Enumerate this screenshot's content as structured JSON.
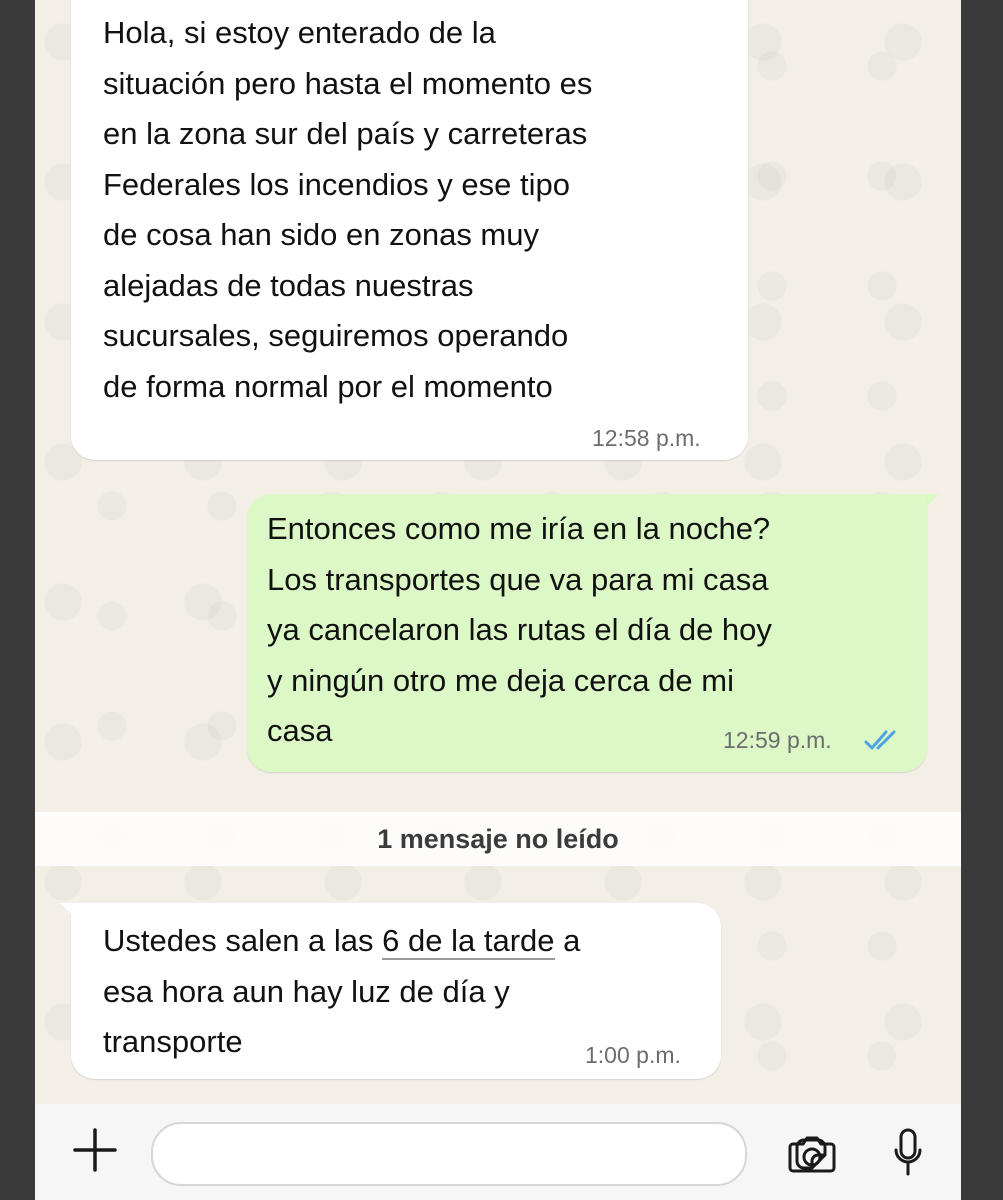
{
  "chat": {
    "messages": [
      {
        "direction": "incoming",
        "lines": [
          "Hola, si estoy enterado de la",
          "situación pero hasta el momento es",
          "en la zona sur del país y carreteras",
          "Federales los incendios y ese tipo",
          "de cosa han sido en zonas muy",
          "alejadas de todas nuestras",
          "sucursales, seguiremos operando",
          "de forma normal por el momento"
        ],
        "time": "12:58 p.m."
      },
      {
        "direction": "outgoing",
        "lines": [
          "Entonces como me iría en la noche?",
          "Los transportes que va para mi casa",
          "ya cancelaron las rutas el día de hoy",
          "y ningún otro me deja cerca de mi",
          "casa"
        ],
        "time": "12:59 p.m.",
        "status_icon": "double-check-read-icon"
      },
      {
        "direction": "incoming",
        "line1_before": "Ustedes salen a las ",
        "line1_link": "6 de la tarde",
        "line1_after": " a",
        "line2": "esa hora aun hay luz de día y",
        "line3": "transporte",
        "time": "1:00 p.m."
      }
    ],
    "unread_label": "1 mensaje no leído"
  },
  "composer": {
    "input_value": "",
    "icons": [
      "plus-icon",
      "sticker-icon",
      "camera-icon",
      "microphone-icon"
    ]
  },
  "colors": {
    "incoming_bubble": "#ffffff",
    "outgoing_bubble": "#dcf8c6",
    "read_check": "#4fa3e0",
    "chat_background": "#f3efe7"
  }
}
